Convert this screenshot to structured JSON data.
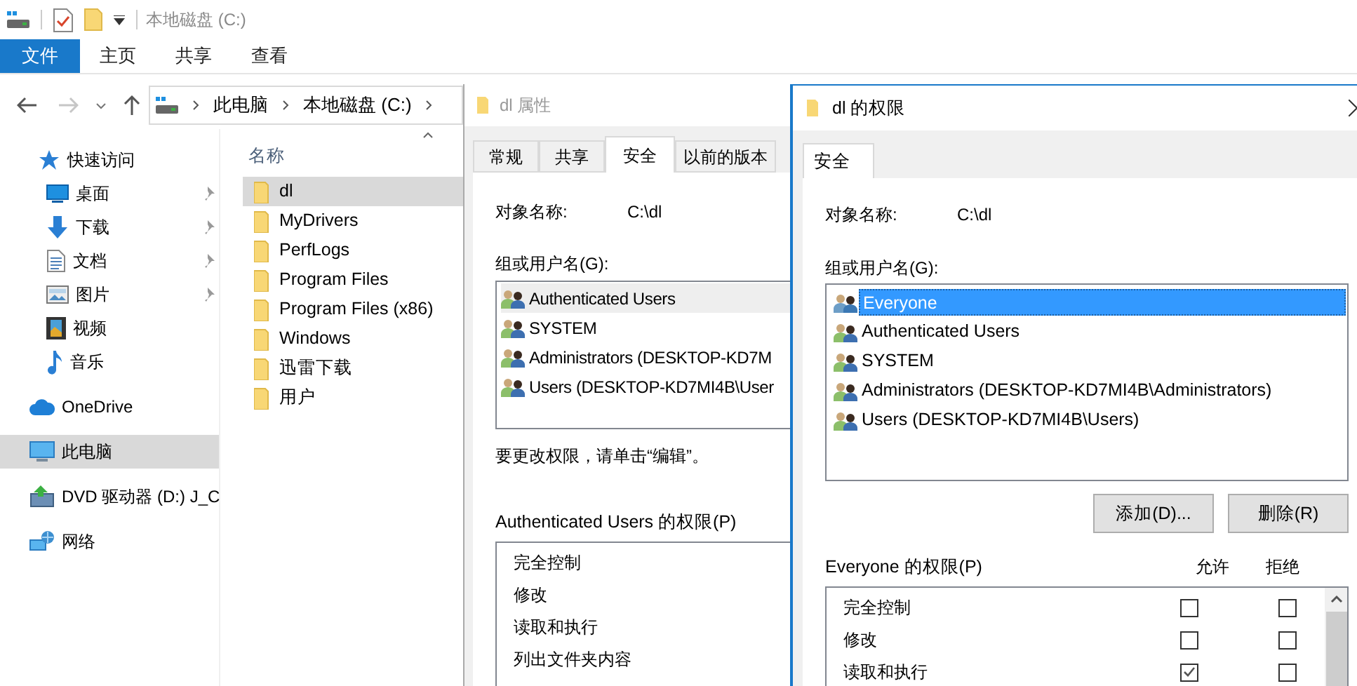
{
  "explorer": {
    "title": "本地磁盘 (C:)",
    "ribbon_tabs": [
      {
        "label": "文件",
        "selected": true
      },
      {
        "label": "主页",
        "selected": false
      },
      {
        "label": "共享",
        "selected": false
      },
      {
        "label": "查看",
        "selected": false
      }
    ],
    "breadcrumb": [
      "此电脑",
      "本地磁盘 (C:)"
    ],
    "nav_items": [
      {
        "label": "快速访问",
        "kind": "star",
        "pinned": false,
        "selected": false
      },
      {
        "label": "桌面",
        "kind": "desktop",
        "pinned": true,
        "selected": false
      },
      {
        "label": "下载",
        "kind": "download",
        "pinned": true,
        "selected": false
      },
      {
        "label": "文档",
        "kind": "document",
        "pinned": true,
        "selected": false
      },
      {
        "label": "图片",
        "kind": "pictures",
        "pinned": true,
        "selected": false
      },
      {
        "label": "视频",
        "kind": "video",
        "pinned": false,
        "selected": false
      },
      {
        "label": "音乐",
        "kind": "music",
        "pinned": false,
        "selected": false
      },
      {
        "label": "OneDrive",
        "kind": "cloud",
        "pinned": false,
        "selected": false
      },
      {
        "label": "此电脑",
        "kind": "pc",
        "pinned": false,
        "selected": true
      },
      {
        "label": "DVD 驱动器 (D:) J_C",
        "kind": "dvd",
        "pinned": false,
        "selected": false
      },
      {
        "label": "网络",
        "kind": "network",
        "pinned": false,
        "selected": false
      }
    ],
    "column_header": "名称",
    "files": [
      {
        "name": "dl",
        "selected": true
      },
      {
        "name": "MyDrivers",
        "selected": false
      },
      {
        "name": "PerfLogs",
        "selected": false
      },
      {
        "name": "Program Files",
        "selected": false
      },
      {
        "name": "Program Files (x86)",
        "selected": false
      },
      {
        "name": "Windows",
        "selected": false
      },
      {
        "name": "迅雷下载",
        "selected": false
      },
      {
        "name": "用户",
        "selected": false
      }
    ]
  },
  "properties_dialog": {
    "title": "dl 属性",
    "tabs": [
      {
        "label": "常规",
        "selected": false
      },
      {
        "label": "共享",
        "selected": false
      },
      {
        "label": "安全",
        "selected": true
      },
      {
        "label": "以前的版本",
        "selected": false
      }
    ],
    "object_label": "对象名称:",
    "object_value": "C:\\dl",
    "group_label": "组或用户名(G):",
    "users": [
      {
        "name": "Authenticated Users",
        "highlighted": true
      },
      {
        "name": "SYSTEM",
        "highlighted": false
      },
      {
        "name": "Administrators (DESKTOP-KD7M",
        "highlighted": false
      },
      {
        "name": "Users (DESKTOP-KD7MI4B\\User",
        "highlighted": false
      }
    ],
    "hint": "要更改权限，请单击“编辑”。",
    "permissions_label": "Authenticated Users 的权限(P)",
    "permissions": [
      "完全控制",
      "修改",
      "读取和执行",
      "列出文件夹内容"
    ]
  },
  "permissions_dialog": {
    "title": "dl 的权限",
    "tabs": [
      {
        "label": "安全",
        "selected": true
      }
    ],
    "object_label": "对象名称:",
    "object_value": "C:\\dl",
    "group_label": "组或用户名(G):",
    "users": [
      {
        "name": "Everyone",
        "selected": true
      },
      {
        "name": "Authenticated Users",
        "selected": false
      },
      {
        "name": "SYSTEM",
        "selected": false
      },
      {
        "name": "Administrators (DESKTOP-KD7MI4B\\Administrators)",
        "selected": false
      },
      {
        "name": "Users (DESKTOP-KD7MI4B\\Users)",
        "selected": false
      }
    ],
    "buttons": [
      "添加(D)...",
      "删除(R)"
    ],
    "permissions_label": "Everyone 的权限(P)",
    "allow_header": "允许",
    "deny_header": "拒绝",
    "permissions": [
      {
        "name": "完全控制",
        "allow": false,
        "deny": false
      },
      {
        "name": "修改",
        "allow": false,
        "deny": false
      },
      {
        "name": "读取和执行",
        "allow": true,
        "deny": false
      }
    ]
  }
}
